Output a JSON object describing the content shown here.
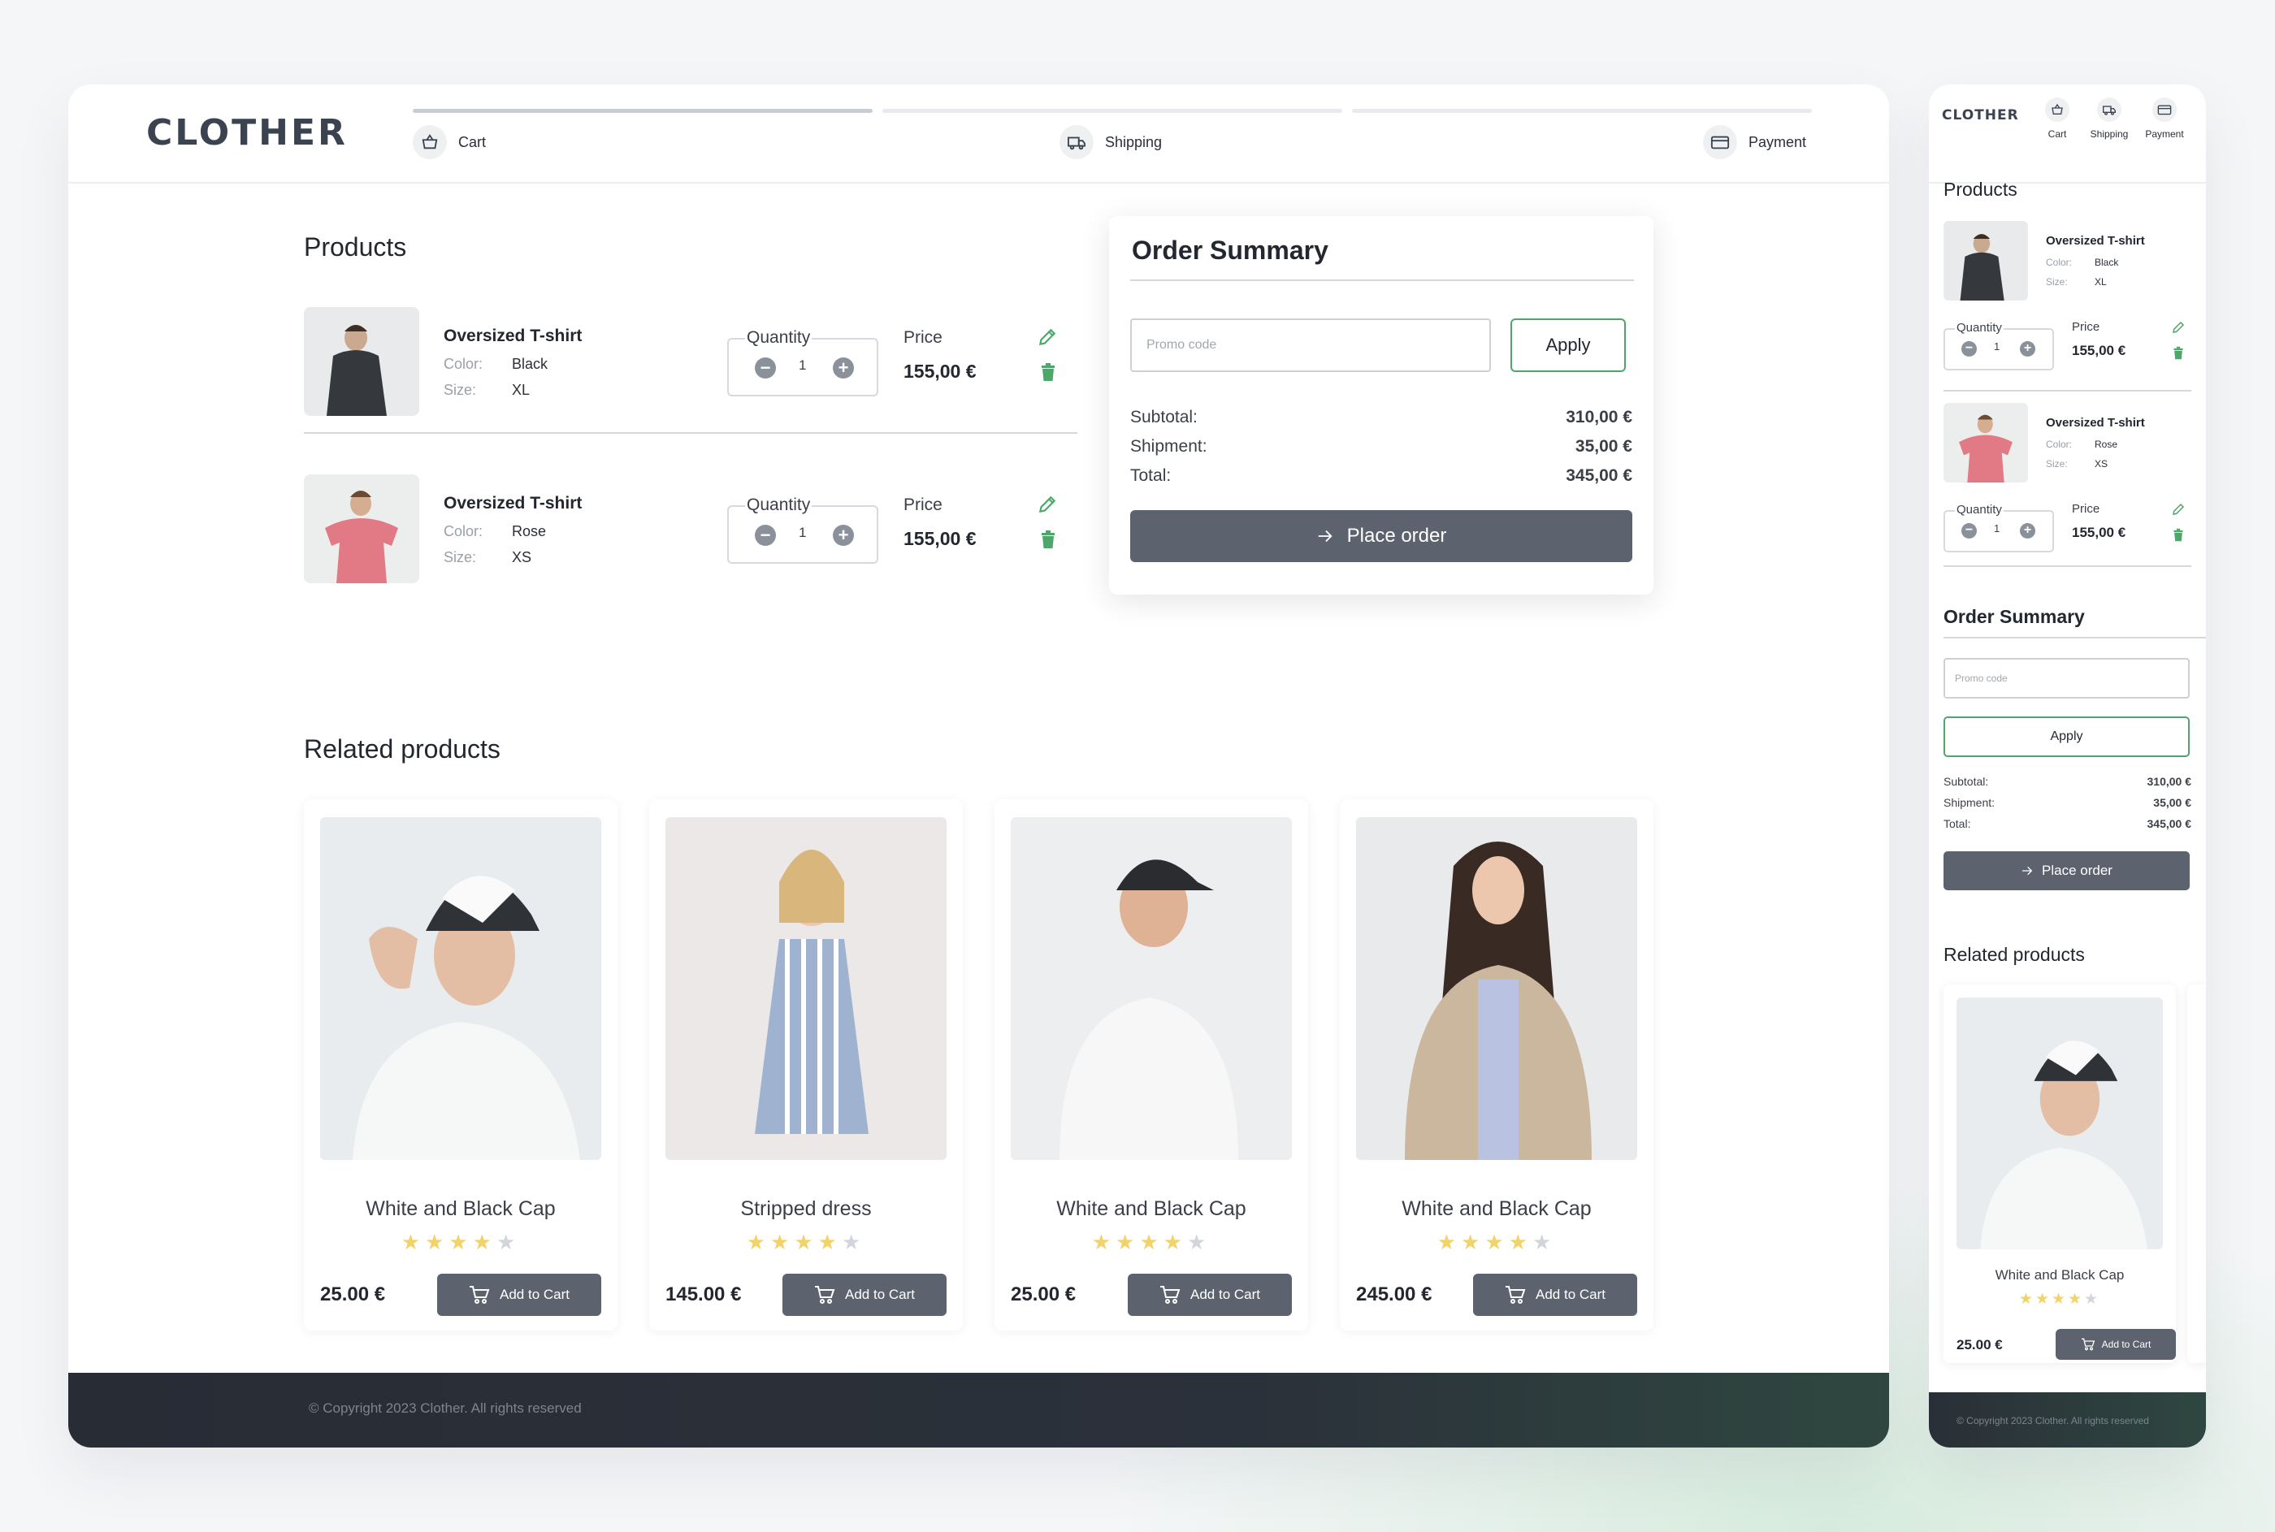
{
  "brand": "CLOTHER",
  "steps": [
    {
      "label": "Cart",
      "icon": "basket-icon"
    },
    {
      "label": "Shipping",
      "icon": "truck-icon"
    },
    {
      "label": "Payment",
      "icon": "card-icon"
    }
  ],
  "products_title": "Products",
  "quantity_label": "Quantity",
  "price_label": "Price",
  "color_label": "Color:",
  "size_label": "Size:",
  "products": [
    {
      "name": "Oversized T-shirt",
      "color": "Black",
      "size": "XL",
      "quantity": "1",
      "price": "155,00 €"
    },
    {
      "name": "Oversized T-shirt",
      "color": "Rose",
      "size": "XS",
      "quantity": "1",
      "price": "155,00 €"
    }
  ],
  "summary": {
    "title": "Order Summary",
    "promo_placeholder": "Promo code",
    "apply_label": "Apply",
    "subtotal_label": "Subtotal:",
    "subtotal": "310,00 €",
    "shipment_label": "Shipment:",
    "shipment": "35,00 €",
    "total_label": "Total:",
    "total": "345,00 €",
    "place_order_label": "Place order"
  },
  "related_title": "Related products",
  "add_to_cart_label": "Add to Cart",
  "related": [
    {
      "name": "White and Black Cap",
      "price": "25.00 €",
      "rating": 4
    },
    {
      "name": "Stripped dress",
      "price": "145.00 €",
      "rating": 4
    },
    {
      "name": "White and Black Cap",
      "price": "25.00 €",
      "rating": 4
    },
    {
      "name": "White and Black Cap",
      "price": "245.00 €",
      "rating": 4
    }
  ],
  "copyright": "© Copyright 2023 Clother. All rights reserved",
  "colors": {
    "accent_green": "#4fa66b",
    "button_dark": "#5c636e",
    "footer": "#282c35",
    "star": "#f1d36a"
  }
}
